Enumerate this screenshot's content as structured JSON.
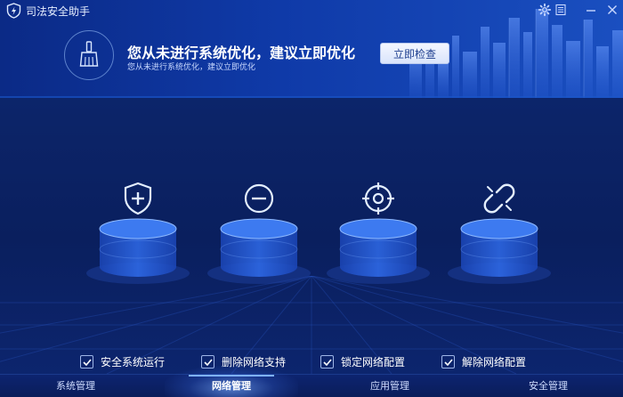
{
  "app": {
    "title": "司法安全助手"
  },
  "banner": {
    "headline": "您从未进行系统优化，建议立即优化",
    "subline": "您从未进行系统优化，建议立即优化",
    "button_label": "立即检查"
  },
  "features": [
    {
      "label": "安全系统运行",
      "icon": "shield-plus-icon",
      "checked": true
    },
    {
      "label": "删除网络支持",
      "icon": "minus-circle-icon",
      "checked": true
    },
    {
      "label": "锁定网络配置",
      "icon": "target-icon",
      "checked": true
    },
    {
      "label": "解除网络配置",
      "icon": "broken-link-icon",
      "checked": true
    }
  ],
  "nav": {
    "tabs": [
      {
        "label": "系统管理",
        "active": false
      },
      {
        "label": "网络管理",
        "active": true
      },
      {
        "label": "应用管理",
        "active": false
      },
      {
        "label": "安全管理",
        "active": false
      }
    ]
  },
  "colors": {
    "accent": "#4f8fff",
    "background": "#0b1f5c",
    "header": "#0f3aa8"
  }
}
